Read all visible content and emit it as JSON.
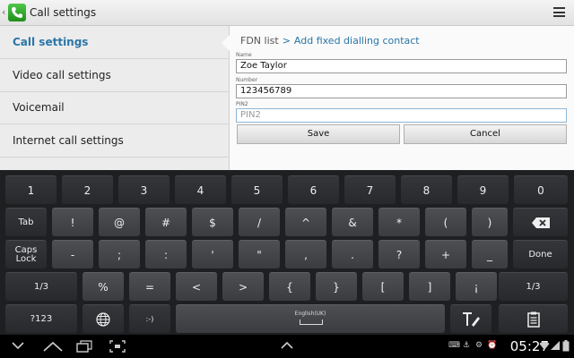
{
  "titlebar": {
    "title": "Call settings"
  },
  "sidebar": {
    "items": [
      {
        "label": "Call settings",
        "selected": true
      },
      {
        "label": "Video call settings",
        "selected": false
      },
      {
        "label": "Voicemail",
        "selected": false
      },
      {
        "label": "Internet call settings",
        "selected": false
      }
    ]
  },
  "breadcrumb": {
    "parent": "FDN list",
    "separator": ">",
    "current": "Add fixed dialling contact"
  },
  "form": {
    "name_label": "Name",
    "name_value": "Zoe Taylor",
    "number_label": "Number",
    "number_value": "123456789",
    "pin2_label": "PIN2",
    "pin2_placeholder": "PIN2",
    "save_label": "Save",
    "cancel_label": "Cancel"
  },
  "keyboard": {
    "row1": [
      "1",
      "2",
      "3",
      "4",
      "5",
      "6",
      "7",
      "8",
      "9",
      "0"
    ],
    "tab": "Tab",
    "row2": [
      "!",
      "@",
      "#",
      "$",
      "/",
      "^",
      "&",
      "*",
      "(",
      ")"
    ],
    "caps_line1": "Caps",
    "caps_line2": "Lock",
    "row3": [
      "-",
      ";",
      ":",
      "'",
      "\"",
      ",",
      ".",
      "?",
      "+",
      "_"
    ],
    "done": "Done",
    "page_left": "1/3",
    "row4": [
      "%",
      "=",
      "<",
      ">",
      "{",
      "}",
      "[",
      "]",
      "¡"
    ],
    "page_right": "1/3",
    "sym": "?123",
    "emoticon": ":-)",
    "language": "English(UK)"
  },
  "statusbar": {
    "time": "05:27"
  },
  "colors": {
    "accent": "#2a76a8",
    "keyboard_bg": "#1e1f21"
  }
}
